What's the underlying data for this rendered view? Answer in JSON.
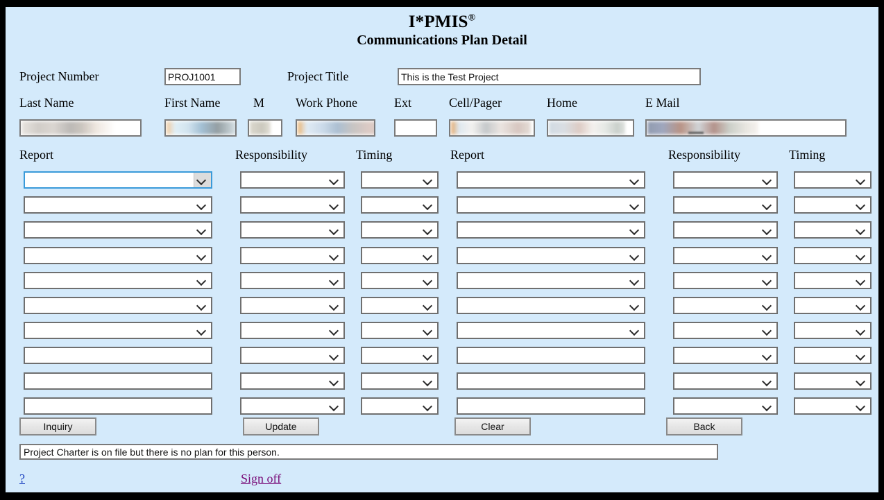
{
  "window": {
    "background": "#d4eafb",
    "border_color": "#000000"
  },
  "header": {
    "app_title": "I*PMIS",
    "registered_mark": "®",
    "page_title": "Communications Plan Detail"
  },
  "project": {
    "number_label": "Project Number",
    "number_value": "PROJ1001",
    "title_label": "Project Title",
    "title_value": "This is the Test Project"
  },
  "person": {
    "labels": {
      "last_name": "Last Name",
      "first_name": "First Name",
      "middle": "M",
      "work_phone": "Work Phone",
      "ext": "Ext",
      "cell_pager": "Cell/Pager",
      "home": "Home",
      "email": "E Mail"
    },
    "values": {
      "last_name": "",
      "first_name": "",
      "middle": "",
      "work_phone": "",
      "ext": "",
      "cell_pager": "",
      "home": "",
      "email": ""
    }
  },
  "plan_table": {
    "headers": {
      "report": "Report",
      "responsibility": "Responsibility",
      "timing": "Timing"
    },
    "left_rows": [
      {
        "report": "",
        "report_type": "select",
        "responsibility": "",
        "timing": ""
      },
      {
        "report": "",
        "report_type": "select",
        "responsibility": "",
        "timing": ""
      },
      {
        "report": "",
        "report_type": "select",
        "responsibility": "",
        "timing": ""
      },
      {
        "report": "",
        "report_type": "select",
        "responsibility": "",
        "timing": ""
      },
      {
        "report": "",
        "report_type": "select",
        "responsibility": "",
        "timing": ""
      },
      {
        "report": "",
        "report_type": "select",
        "responsibility": "",
        "timing": ""
      },
      {
        "report": "",
        "report_type": "select",
        "responsibility": "",
        "timing": ""
      },
      {
        "report": "",
        "report_type": "text",
        "responsibility": "",
        "timing": ""
      },
      {
        "report": "",
        "report_type": "text",
        "responsibility": "",
        "timing": ""
      },
      {
        "report": "",
        "report_type": "text",
        "responsibility": "",
        "timing": ""
      }
    ],
    "right_rows": [
      {
        "report": "",
        "report_type": "select",
        "responsibility": "",
        "timing": ""
      },
      {
        "report": "",
        "report_type": "select",
        "responsibility": "",
        "timing": ""
      },
      {
        "report": "",
        "report_type": "select",
        "responsibility": "",
        "timing": ""
      },
      {
        "report": "",
        "report_type": "select",
        "responsibility": "",
        "timing": ""
      },
      {
        "report": "",
        "report_type": "select",
        "responsibility": "",
        "timing": ""
      },
      {
        "report": "",
        "report_type": "select",
        "responsibility": "",
        "timing": ""
      },
      {
        "report": "",
        "report_type": "select",
        "responsibility": "",
        "timing": ""
      },
      {
        "report": "",
        "report_type": "text",
        "responsibility": "",
        "timing": ""
      },
      {
        "report": "",
        "report_type": "text",
        "responsibility": "",
        "timing": ""
      },
      {
        "report": "",
        "report_type": "text",
        "responsibility": "",
        "timing": ""
      }
    ]
  },
  "buttons": {
    "inquiry": "Inquiry",
    "update": "Update",
    "clear": "Clear",
    "back": "Back"
  },
  "status": {
    "message": "Project Charter is on file but there is no plan for this person."
  },
  "footer": {
    "help_link": "?",
    "signoff_link": "Sign off"
  }
}
